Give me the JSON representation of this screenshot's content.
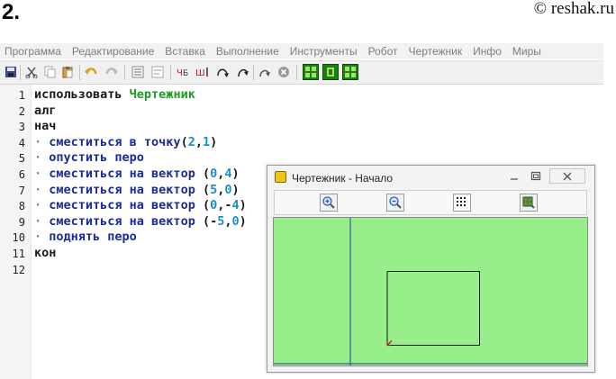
{
  "header": {
    "task_number": "2.",
    "watermark": "© reshak.ru"
  },
  "menubar": {
    "items": [
      "Программа",
      "Редактирование",
      "Вставка",
      "Выполнение",
      "Инструменты",
      "Робот",
      "Чертежник",
      "Инфо",
      "Миры"
    ]
  },
  "toolbar": {
    "icons": [
      "save-icon",
      "cut-icon",
      "copy-icon",
      "paste-icon",
      "undo-icon",
      "redo-icon",
      "insert-line-icon",
      "remove-line-icon",
      "sort-icon",
      "indent-icon",
      "step-into-icon",
      "step-over-icon",
      "step-run-icon",
      "stop-icon",
      "grid-icon",
      "frame-icon",
      "grid-alt-icon"
    ]
  },
  "editor": {
    "line_numbers": [
      "1",
      "2",
      "3",
      "4",
      "5",
      "6",
      "7",
      "8",
      "9",
      "10",
      "11",
      "12"
    ],
    "lines": [
      [
        {
          "t": "использовать ",
          "c": "plain"
        },
        {
          "t": "Чертежник",
          "c": "green"
        }
      ],
      [
        {
          "t": "алг",
          "c": "plain"
        }
      ],
      [
        {
          "t": "нач",
          "c": "plain"
        }
      ],
      [
        {
          "t": "· ",
          "c": "dot"
        },
        {
          "t": "сместиться в точку",
          "c": "blue"
        },
        {
          "t": "(",
          "c": "plain"
        },
        {
          "t": "2",
          "c": "num"
        },
        {
          "t": ",",
          "c": "plain"
        },
        {
          "t": "1",
          "c": "num"
        },
        {
          "t": ")",
          "c": "plain"
        }
      ],
      [
        {
          "t": "· ",
          "c": "dot"
        },
        {
          "t": "опустить перо",
          "c": "blue"
        }
      ],
      [
        {
          "t": "· ",
          "c": "dot"
        },
        {
          "t": "сместиться на вектор ",
          "c": "blue"
        },
        {
          "t": "(",
          "c": "plain"
        },
        {
          "t": "0",
          "c": "num"
        },
        {
          "t": ",",
          "c": "plain"
        },
        {
          "t": "4",
          "c": "num"
        },
        {
          "t": ")",
          "c": "plain"
        }
      ],
      [
        {
          "t": "· ",
          "c": "dot"
        },
        {
          "t": "сместиться на вектор ",
          "c": "blue"
        },
        {
          "t": "(",
          "c": "plain"
        },
        {
          "t": "5",
          "c": "num"
        },
        {
          "t": ",",
          "c": "plain"
        },
        {
          "t": "0",
          "c": "num"
        },
        {
          "t": ")",
          "c": "plain"
        }
      ],
      [
        {
          "t": "· ",
          "c": "dot"
        },
        {
          "t": "сместиться на вектор ",
          "c": "blue"
        },
        {
          "t": "(",
          "c": "plain"
        },
        {
          "t": "0",
          "c": "num"
        },
        {
          "t": ",-",
          "c": "plain"
        },
        {
          "t": "4",
          "c": "num"
        },
        {
          "t": ")",
          "c": "plain"
        }
      ],
      [
        {
          "t": "· ",
          "c": "dot"
        },
        {
          "t": "сместиться на вектор ",
          "c": "blue"
        },
        {
          "t": "(-",
          "c": "plain"
        },
        {
          "t": "5",
          "c": "num"
        },
        {
          "t": ",",
          "c": "plain"
        },
        {
          "t": "0",
          "c": "num"
        },
        {
          "t": ")",
          "c": "plain"
        }
      ],
      [
        {
          "t": "· ",
          "c": "dot"
        },
        {
          "t": "поднять перо",
          "c": "blue"
        }
      ],
      [
        {
          "t": "кон",
          "c": "plain"
        }
      ],
      []
    ]
  },
  "drawer_window": {
    "title": "Чертежник - Начало",
    "buttons": [
      "zoom-in-icon",
      "zoom-out-icon",
      "grid-dots-icon",
      "fit-icon"
    ],
    "canvas_color": "#97ee8b",
    "drawing": {
      "start_point": [
        2,
        1
      ],
      "vectors": [
        [
          0,
          4
        ],
        [
          5,
          0
        ],
        [
          0,
          -4
        ],
        [
          -5,
          0
        ]
      ]
    }
  }
}
